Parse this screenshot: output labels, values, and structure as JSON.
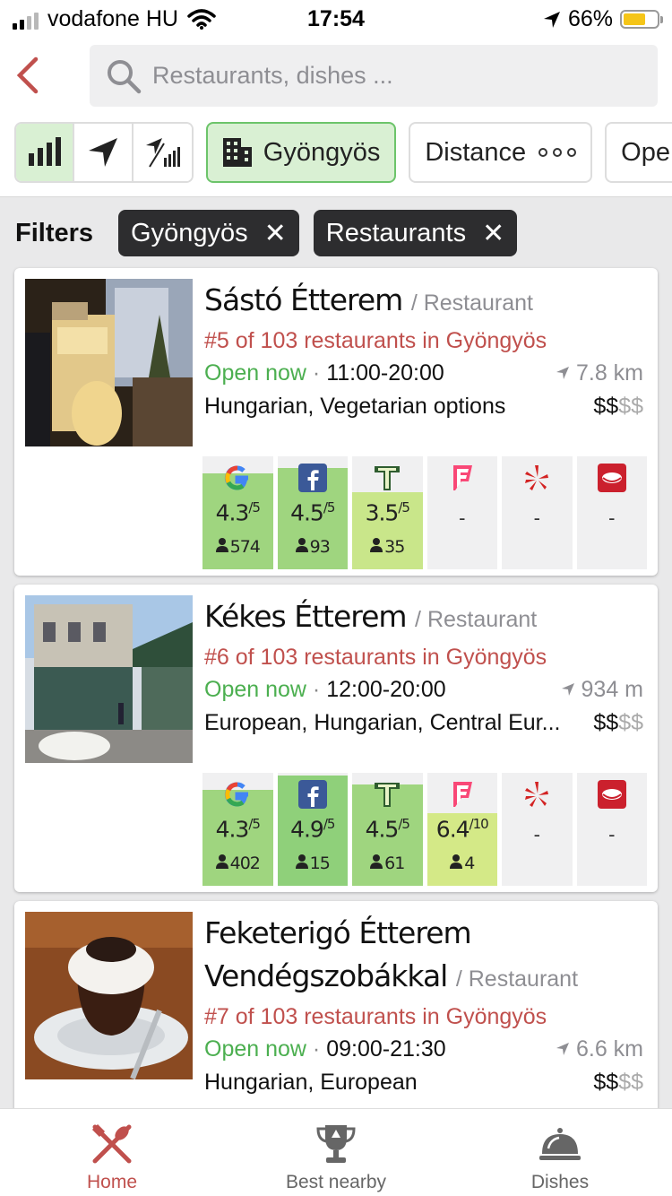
{
  "status": {
    "carrier": "vodafone HU",
    "time": "17:54",
    "battery": "66%",
    "battery_level": 0.66
  },
  "search": {
    "placeholder": "Restaurants, dishes ..."
  },
  "chips": {
    "city": "Gyöngyös",
    "sort": "Distance",
    "open": "Ope"
  },
  "filters": {
    "label": "Filters",
    "tags": [
      {
        "label": "Gyöngyös",
        "close": "✕"
      },
      {
        "label": "Restaurants",
        "close": "✕"
      }
    ]
  },
  "restaurants": [
    {
      "name": "Sástó Étterem",
      "type": "/ Restaurant",
      "rank": "#5 of 103 restaurants in Gyöngyös",
      "open": "Open now",
      "hours": "11:00-20:00",
      "distance": "7.8 km",
      "cuisine": "Hungarian, Vegetarian options",
      "price_on": "$$",
      "price_off": "$$",
      "ratings": [
        {
          "src": "google-icon",
          "score": "4.3",
          "max": "/5",
          "count": "574",
          "fill": 0.85,
          "color": "#9fd57f"
        },
        {
          "src": "facebook-icon",
          "score": "4.5",
          "max": "/5",
          "count": "93",
          "fill": 0.9,
          "color": "#9fd57f"
        },
        {
          "src": "tripadvisor-icon",
          "score": "3.5",
          "max": "/5",
          "count": "35",
          "fill": 0.68,
          "color": "#c9e68a"
        },
        {
          "src": "foursquare-icon",
          "score": "-",
          "fill": 0
        },
        {
          "src": "yelp-icon",
          "score": "-",
          "fill": 0
        },
        {
          "src": "zomato-icon",
          "score": "-",
          "fill": 0
        }
      ]
    },
    {
      "name": "Kékes Étterem",
      "type": "/ Restaurant",
      "rank": "#6 of 103 restaurants in Gyöngyös",
      "open": "Open now",
      "hours": "12:00-20:00",
      "distance": "934 m",
      "cuisine": "European, Hungarian, Central Eur...",
      "price_on": "$$",
      "price_off": "$$",
      "ratings": [
        {
          "src": "google-icon",
          "score": "4.3",
          "max": "/5",
          "count": "402",
          "fill": 0.85,
          "color": "#9fd57f"
        },
        {
          "src": "facebook-icon",
          "score": "4.9",
          "max": "/5",
          "count": "15",
          "fill": 0.98,
          "color": "#8fd07a"
        },
        {
          "src": "tripadvisor-icon",
          "score": "4.5",
          "max": "/5",
          "count": "61",
          "fill": 0.9,
          "color": "#9fd57f"
        },
        {
          "src": "foursquare-icon",
          "score": "6.4",
          "max": "/10",
          "count": "4",
          "fill": 0.64,
          "color": "#d4e987"
        },
        {
          "src": "yelp-icon",
          "score": "-",
          "fill": 0
        },
        {
          "src": "zomato-icon",
          "score": "-",
          "fill": 0
        }
      ]
    },
    {
      "name": "Feketerigó Étterem",
      "name2": "Vendégszobákkal",
      "type": "/ Restaurant",
      "rank": "#7 of 103 restaurants in Gyöngyös",
      "open": "Open now",
      "hours": "09:00-21:30",
      "distance": "6.6 km",
      "cuisine": "Hungarian, European",
      "price_on": "$$",
      "price_off": "$$"
    }
  ],
  "tabs": [
    {
      "label": "Home",
      "icon": "fork-knife-icon",
      "active": true
    },
    {
      "label": "Best nearby",
      "icon": "trophy-icon",
      "active": false
    },
    {
      "label": "Dishes",
      "icon": "cloche-icon",
      "active": false
    }
  ],
  "colors": {
    "accent": "#c0504d",
    "open": "#4caf50",
    "chip_active": "#d9f0d3"
  }
}
